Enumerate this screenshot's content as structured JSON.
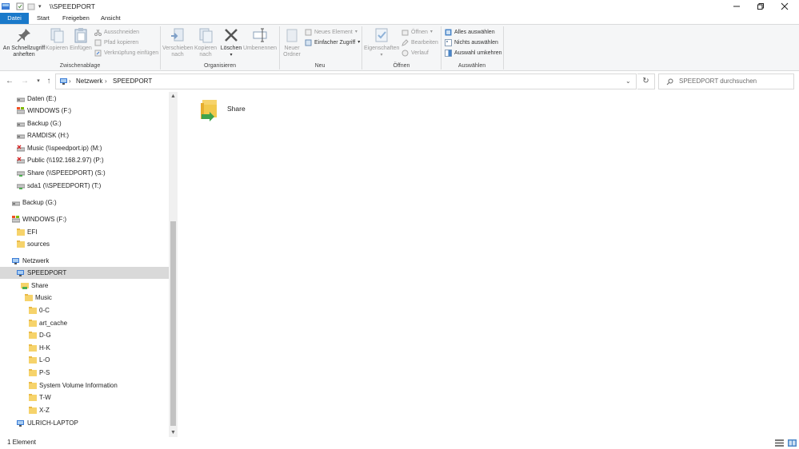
{
  "window": {
    "title": "\\\\SPEEDPORT",
    "minimize_icon": "minimize-icon",
    "maximize_icon": "restore-icon",
    "close_icon": "close-icon"
  },
  "tabs": [
    {
      "label": "Datei"
    },
    {
      "label": "Start"
    },
    {
      "label": "Freigeben"
    },
    {
      "label": "Ansicht"
    }
  ],
  "ribbon": {
    "clipboard": {
      "pin_label_1": "An Schnellzugriff",
      "pin_label_2": "anheften",
      "copy_label": "Kopieren",
      "paste_label": "Einfügen",
      "cut_label": "Ausschneiden",
      "copy_path_label": "Pfad kopieren",
      "paste_shortcut_label": "Verknüpfung einfügen",
      "group": "Zwischenablage"
    },
    "organize": {
      "move_label_1": "Verschieben",
      "move_label_2": "nach",
      "copyto_label_1": "Kopieren",
      "copyto_label_2": "nach",
      "delete_label": "Löschen",
      "rename_label": "Umbenennen",
      "group": "Organisieren"
    },
    "new": {
      "new_folder_label_1": "Neuer",
      "new_folder_label_2": "Ordner",
      "new_item_label": "Neues Element",
      "easy_access_label": "Einfacher Zugriff",
      "group": "Neu"
    },
    "open": {
      "properties_label": "Eigenschaften",
      "open_label": "Öffnen",
      "edit_label": "Bearbeiten",
      "history_label": "Verlauf",
      "group": "Öffnen"
    },
    "select": {
      "select_all_label": "Alles auswählen",
      "select_none_label": "Nichts auswählen",
      "invert_label": "Auswahl umkehren",
      "group": "Auswählen"
    }
  },
  "address": {
    "crumbs": [
      "Netzwerk",
      "SPEEDPORT"
    ],
    "search_placeholder": "SPEEDPORT durchsuchen"
  },
  "tree": [
    {
      "label": "Daten (E:)",
      "icon": "drive-icon"
    },
    {
      "label": "WINDOWS (F:)",
      "icon": "windows-drive-icon"
    },
    {
      "label": "Backup (G:)",
      "icon": "drive-icon"
    },
    {
      "label": "RAMDISK (H:)",
      "icon": "drive-icon"
    },
    {
      "label": "Music (\\\\speedport.ip) (M:)",
      "icon": "disconnected-network-drive-icon"
    },
    {
      "label": "Public (\\\\192.168.2.97) (P:)",
      "icon": "disconnected-network-drive-icon"
    },
    {
      "label": "Share (\\\\SPEEDPORT) (S:)",
      "icon": "network-drive-icon"
    },
    {
      "label": "sda1 (\\\\SPEEDPORT) (T:)",
      "icon": "network-drive-icon"
    },
    {
      "label": "Backup (G:)",
      "icon": "drive-icon"
    },
    {
      "label": "WINDOWS (F:)",
      "icon": "windows-drive-icon"
    },
    {
      "label": "EFI",
      "icon": "folder-icon"
    },
    {
      "label": "sources",
      "icon": "folder-icon"
    },
    {
      "label": "Netzwerk",
      "icon": "network-icon"
    },
    {
      "label": "SPEEDPORT",
      "icon": "computer-icon"
    },
    {
      "label": "Share",
      "icon": "shared-folder-icon"
    },
    {
      "label": "Music",
      "icon": "folder-icon"
    },
    {
      "label": "0-C",
      "icon": "folder-icon"
    },
    {
      "label": "art_cache",
      "icon": "folder-icon"
    },
    {
      "label": "D-G",
      "icon": "folder-icon"
    },
    {
      "label": "H-K",
      "icon": "folder-icon"
    },
    {
      "label": "L-O",
      "icon": "folder-icon"
    },
    {
      "label": "P-S",
      "icon": "folder-icon"
    },
    {
      "label": "System Volume Information",
      "icon": "folder-icon"
    },
    {
      "label": "T-W",
      "icon": "folder-icon"
    },
    {
      "label": "X-Z",
      "icon": "folder-icon"
    },
    {
      "label": "ULRICH-LAPTOP",
      "icon": "computer-icon"
    }
  ],
  "content": {
    "items": [
      {
        "label": "Share",
        "icon": "shared-folder-icon"
      }
    ]
  },
  "status": {
    "count": "1 Element"
  }
}
